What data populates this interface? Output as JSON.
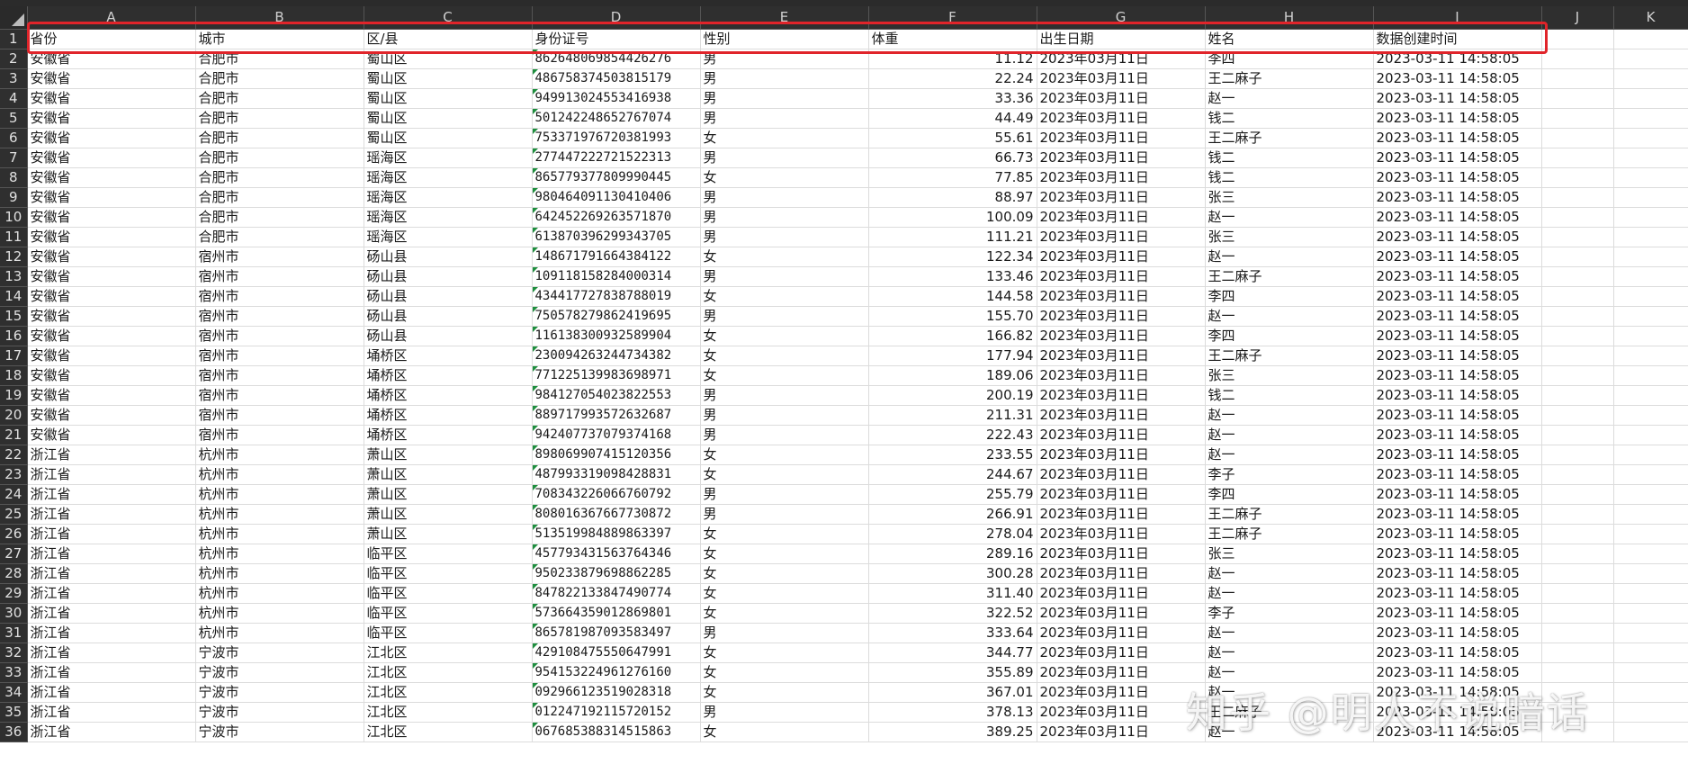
{
  "columns": [
    "A",
    "B",
    "C",
    "D",
    "E",
    "F",
    "G",
    "H",
    "I",
    "J",
    "K"
  ],
  "header_row": [
    "省份",
    "城市",
    "区/县",
    "身份证号",
    "性别",
    "体重",
    "出生日期",
    "姓名",
    "数据创建时间"
  ],
  "rows": [
    [
      "安徽省",
      "合肥市",
      "蜀山区",
      "862648069854426276",
      "男",
      "11.12",
      "2023年03月11日",
      "李四",
      "2023-03-11 14:58:05"
    ],
    [
      "安徽省",
      "合肥市",
      "蜀山区",
      "486758374503815179",
      "男",
      "22.24",
      "2023年03月11日",
      "王二麻子",
      "2023-03-11 14:58:05"
    ],
    [
      "安徽省",
      "合肥市",
      "蜀山区",
      "949913024553416938",
      "男",
      "33.36",
      "2023年03月11日",
      "赵一",
      "2023-03-11 14:58:05"
    ],
    [
      "安徽省",
      "合肥市",
      "蜀山区",
      "501242248652767074",
      "男",
      "44.49",
      "2023年03月11日",
      "钱二",
      "2023-03-11 14:58:05"
    ],
    [
      "安徽省",
      "合肥市",
      "蜀山区",
      "753371976720381993",
      "女",
      "55.61",
      "2023年03月11日",
      "王二麻子",
      "2023-03-11 14:58:05"
    ],
    [
      "安徽省",
      "合肥市",
      "瑶海区",
      "277447222721522313",
      "男",
      "66.73",
      "2023年03月11日",
      "钱二",
      "2023-03-11 14:58:05"
    ],
    [
      "安徽省",
      "合肥市",
      "瑶海区",
      "865779377809990445",
      "女",
      "77.85",
      "2023年03月11日",
      "钱二",
      "2023-03-11 14:58:05"
    ],
    [
      "安徽省",
      "合肥市",
      "瑶海区",
      "980464091130410406",
      "男",
      "88.97",
      "2023年03月11日",
      "张三",
      "2023-03-11 14:58:05"
    ],
    [
      "安徽省",
      "合肥市",
      "瑶海区",
      "642452269263571870",
      "男",
      "100.09",
      "2023年03月11日",
      "赵一",
      "2023-03-11 14:58:05"
    ],
    [
      "安徽省",
      "合肥市",
      "瑶海区",
      "613870396299343705",
      "男",
      "111.21",
      "2023年03月11日",
      "张三",
      "2023-03-11 14:58:05"
    ],
    [
      "安徽省",
      "宿州市",
      "砀山县",
      "148671791664384122",
      "女",
      "122.34",
      "2023年03月11日",
      "赵一",
      "2023-03-11 14:58:05"
    ],
    [
      "安徽省",
      "宿州市",
      "砀山县",
      "109118158284000314",
      "男",
      "133.46",
      "2023年03月11日",
      "王二麻子",
      "2023-03-11 14:58:05"
    ],
    [
      "安徽省",
      "宿州市",
      "砀山县",
      "434417727838788019",
      "女",
      "144.58",
      "2023年03月11日",
      "李四",
      "2023-03-11 14:58:05"
    ],
    [
      "安徽省",
      "宿州市",
      "砀山县",
      "750578279862419695",
      "男",
      "155.70",
      "2023年03月11日",
      "赵一",
      "2023-03-11 14:58:05"
    ],
    [
      "安徽省",
      "宿州市",
      "砀山县",
      "116138300932589904",
      "女",
      "166.82",
      "2023年03月11日",
      "李四",
      "2023-03-11 14:58:05"
    ],
    [
      "安徽省",
      "宿州市",
      "埇桥区",
      "230094263244734382",
      "女",
      "177.94",
      "2023年03月11日",
      "王二麻子",
      "2023-03-11 14:58:05"
    ],
    [
      "安徽省",
      "宿州市",
      "埇桥区",
      "771225139983698971",
      "女",
      "189.06",
      "2023年03月11日",
      "张三",
      "2023-03-11 14:58:05"
    ],
    [
      "安徽省",
      "宿州市",
      "埇桥区",
      "984127054023822553",
      "男",
      "200.19",
      "2023年03月11日",
      "钱二",
      "2023-03-11 14:58:05"
    ],
    [
      "安徽省",
      "宿州市",
      "埇桥区",
      "889717993572632687",
      "男",
      "211.31",
      "2023年03月11日",
      "赵一",
      "2023-03-11 14:58:05"
    ],
    [
      "安徽省",
      "宿州市",
      "埇桥区",
      "942407737079374168",
      "男",
      "222.43",
      "2023年03月11日",
      "赵一",
      "2023-03-11 14:58:05"
    ],
    [
      "浙江省",
      "杭州市",
      "萧山区",
      "898069907415120356",
      "女",
      "233.55",
      "2023年03月11日",
      "赵一",
      "2023-03-11 14:58:05"
    ],
    [
      "浙江省",
      "杭州市",
      "萧山区",
      "487993319098428831",
      "女",
      "244.67",
      "2023年03月11日",
      "李子",
      "2023-03-11 14:58:05"
    ],
    [
      "浙江省",
      "杭州市",
      "萧山区",
      "708343226066760792",
      "男",
      "255.79",
      "2023年03月11日",
      "李四",
      "2023-03-11 14:58:05"
    ],
    [
      "浙江省",
      "杭州市",
      "萧山区",
      "808016367667730872",
      "男",
      "266.91",
      "2023年03月11日",
      "王二麻子",
      "2023-03-11 14:58:05"
    ],
    [
      "浙江省",
      "杭州市",
      "萧山区",
      "513519984889863397",
      "女",
      "278.04",
      "2023年03月11日",
      "王二麻子",
      "2023-03-11 14:58:05"
    ],
    [
      "浙江省",
      "杭州市",
      "临平区",
      "457793431563764346",
      "女",
      "289.16",
      "2023年03月11日",
      "张三",
      "2023-03-11 14:58:05"
    ],
    [
      "浙江省",
      "杭州市",
      "临平区",
      "950233879698862285",
      "女",
      "300.28",
      "2023年03月11日",
      "赵一",
      "2023-03-11 14:58:05"
    ],
    [
      "浙江省",
      "杭州市",
      "临平区",
      "847822133847490774",
      "女",
      "311.40",
      "2023年03月11日",
      "赵一",
      "2023-03-11 14:58:05"
    ],
    [
      "浙江省",
      "杭州市",
      "临平区",
      "573664359012869801",
      "女",
      "322.52",
      "2023年03月11日",
      "李子",
      "2023-03-11 14:58:05"
    ],
    [
      "浙江省",
      "杭州市",
      "临平区",
      "865781987093583497",
      "男",
      "333.64",
      "2023年03月11日",
      "赵一",
      "2023-03-11 14:58:05"
    ],
    [
      "浙江省",
      "宁波市",
      "江北区",
      "429108475550647991",
      "女",
      "344.77",
      "2023年03月11日",
      "赵一",
      "2023-03-11 14:58:05"
    ],
    [
      "浙江省",
      "宁波市",
      "江北区",
      "954153224961276160",
      "女",
      "355.89",
      "2023年03月11日",
      "赵一",
      "2023-03-11 14:58:05"
    ],
    [
      "浙江省",
      "宁波市",
      "江北区",
      "092966123519028318",
      "女",
      "367.01",
      "2023年03月11日",
      "赵一",
      "2023-03-11 14:58:05"
    ],
    [
      "浙江省",
      "宁波市",
      "江北区",
      "012247192115720152",
      "男",
      "378.13",
      "2023年03月11日",
      "王二麻子",
      "2023-03-11 14:58:05"
    ],
    [
      "浙江省",
      "宁波市",
      "江北区",
      "067685388314515863",
      "女",
      "389.25",
      "2023年03月11日",
      "赵一",
      "2023-03-11 14:58:05"
    ]
  ],
  "watermark": "知乎 @明人不说暗话"
}
